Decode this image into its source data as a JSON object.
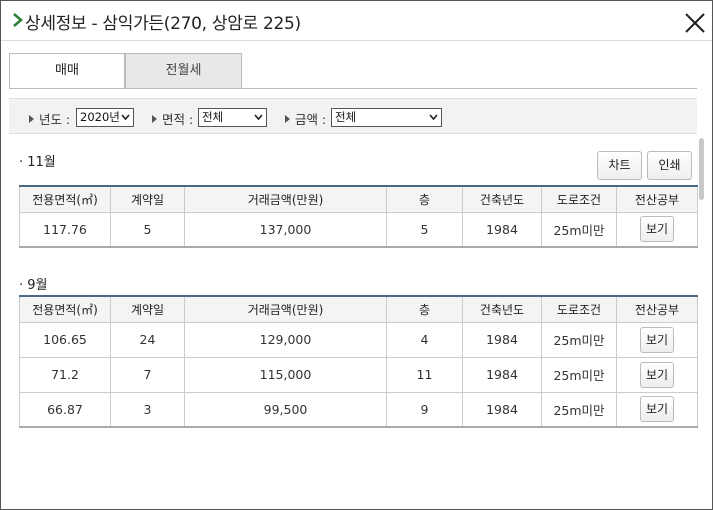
{
  "window": {
    "title": "상세정보 - 삼익가든(270, 상암로 225)"
  },
  "tabs": [
    {
      "label": "매매",
      "active": true
    },
    {
      "label": "전월세",
      "active": false
    }
  ],
  "filters": {
    "year": {
      "label": "년도 :",
      "value": "2020년"
    },
    "area": {
      "label": "면적 :",
      "value": "전체"
    },
    "amount": {
      "label": "금액 :",
      "value": "전체"
    }
  },
  "buttons": {
    "chart": "차트",
    "print": "인쇄"
  },
  "columns": [
    "전용면적(㎡)",
    "계약일",
    "거래금액(만원)",
    "층",
    "건축년도",
    "도로조건",
    "전산공부"
  ],
  "groups": [
    {
      "month": "· 11월",
      "rows": [
        {
          "area": "117.76",
          "day": "5",
          "price": "137,000",
          "floor": "5",
          "built": "1984",
          "road": "25m미만",
          "action": "보기"
        }
      ]
    },
    {
      "month": "· 9월",
      "rows": [
        {
          "area": "106.65",
          "day": "24",
          "price": "129,000",
          "floor": "4",
          "built": "1984",
          "road": "25m미만",
          "action": "보기"
        },
        {
          "area": "71.2",
          "day": "7",
          "price": "115,000",
          "floor": "11",
          "built": "1984",
          "road": "25m미만",
          "action": "보기"
        },
        {
          "area": "66.87",
          "day": "3",
          "price": "99,500",
          "floor": "9",
          "built": "1984",
          "road": "25m미만",
          "action": "보기"
        }
      ]
    }
  ],
  "colors": {
    "accent": "#2e7d32",
    "header_border": "#4a6a8a"
  }
}
